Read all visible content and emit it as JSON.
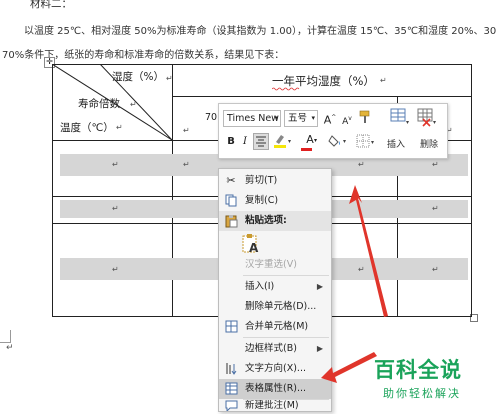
{
  "document": {
    "heading": "材料二：",
    "line1": "以温度 25℃、相对湿度 50%为标准寿命（设其指数为 1.00），计算在温度 15℃、35℃和湿度 20%、30",
    "line2": "70%条件下，纸张的寿命和标准寿命的倍数关系，结果见下表：",
    "pilcrow": "↵"
  },
  "table": {
    "header_humidity": "湿度（%）",
    "header_life": "寿命倍数",
    "header_temperature": "温度（℃）",
    "header_annual": "一年平均湿度（%）",
    "col_partial": "70"
  },
  "mini_toolbar": {
    "font_name": "Times New",
    "font_size": "五号",
    "grow_font": "A",
    "shrink_font": "A",
    "bold": "B",
    "italic": "I",
    "font_color": "A",
    "insert_label": "插入",
    "delete_label": "删除"
  },
  "context_menu": {
    "items": [
      {
        "label": "剪切(T)",
        "icon": "scissors-icon"
      },
      {
        "label": "复制(C)",
        "icon": "copy-icon"
      },
      {
        "label": "粘贴选项:",
        "icon": "paste-icon"
      },
      {
        "label": "汉字重选(V)",
        "icon": ""
      },
      {
        "label": "插入(I)",
        "icon": ""
      },
      {
        "label": "删除单元格(D)...",
        "icon": ""
      },
      {
        "label": "合并单元格(M)",
        "icon": "merge-cells-icon"
      },
      {
        "label": "边框样式(B)",
        "icon": ""
      },
      {
        "label": "文字方向(X)...",
        "icon": "text-direction-icon"
      },
      {
        "label": "表格属性(R)...",
        "icon": "table-properties-icon"
      },
      {
        "label": "新建批注(M)",
        "icon": "new-comment-icon"
      }
    ],
    "paste_option_glyph": "A"
  },
  "watermark": {
    "title": "百科全说",
    "subtitle": "助你轻松解决"
  },
  "colors": {
    "arrow_red": "#e0352b",
    "watermark_green": "#1aa35a",
    "menu_highlight": "#cfcfcf",
    "cell_shade": "#d6d6d6"
  }
}
